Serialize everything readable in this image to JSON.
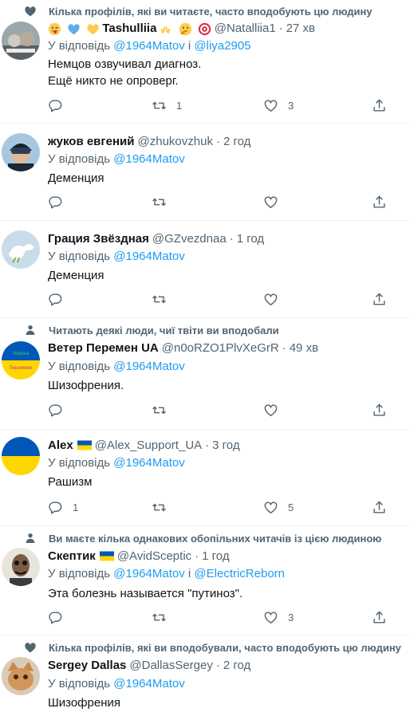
{
  "tweets": [
    {
      "social": "Кілька профілів, які ви читаєте, часто вподобують цю людину",
      "social_icon": "heart-icon",
      "name": "Tashulliia",
      "handle": "@Natalliia1",
      "time": "27 хв",
      "reply_prefix": "У відповідь",
      "reply_to": [
        "@1964Matov",
        "@liya2905"
      ],
      "reply_joiner": "і",
      "text": "Немцов озвучивал диагноз.\nЕщё никто не опроверг.",
      "replies": "",
      "retweets": "1",
      "likes": "3"
    },
    {
      "social": "",
      "name": "жуков евгений",
      "handle": "@zhukovzhuk",
      "time": "2 год",
      "reply_prefix": "У відповідь",
      "reply_to": [
        "@1964Matov"
      ],
      "text": "Деменция",
      "replies": "",
      "retweets": "",
      "likes": ""
    },
    {
      "social": "",
      "name": "Грация Звёздная",
      "handle": "@GZvezdnaa",
      "time": "1 год",
      "reply_prefix": "У відповідь",
      "reply_to": [
        "@1964Matov"
      ],
      "text": "Деменция",
      "replies": "",
      "retweets": "",
      "likes": ""
    },
    {
      "social": "Читають деякі люди, чиї твіти ви вподобали",
      "social_icon": "person-icon",
      "name": "Ветер Перемен UA",
      "handle": "@n0oRZO1PlvXeGrR",
      "time": "49 хв",
      "reply_prefix": "У відповідь",
      "reply_to": [
        "@1964Matov"
      ],
      "text": "Шизофрения.",
      "replies": "",
      "retweets": "",
      "likes": "",
      "avatar_text_top": "Україна",
      "avatar_text_bottom": "Переможе"
    },
    {
      "social": "",
      "name": "Alex",
      "handle": "@Alex_Support_UA",
      "time": "3 год",
      "reply_prefix": "У відповідь",
      "reply_to": [
        "@1964Matov"
      ],
      "text": "Рашизм",
      "replies": "1",
      "retweets": "",
      "likes": "5"
    },
    {
      "social": "Ви маєте кілька однакових обопільних читачів із цією людиною",
      "social_icon": "person-icon",
      "name": "Скептик",
      "handle": "@AvidSceptic",
      "time": "1 год",
      "reply_prefix": "У відповідь",
      "reply_to": [
        "@1964Matov",
        "@ElectricReborn"
      ],
      "reply_joiner": "і",
      "text": "Эта болезнь называется \"путиноз\".",
      "replies": "",
      "retweets": "",
      "likes": "3"
    },
    {
      "social": "Кілька профілів, які ви вподобували, часто вподобують цю людину",
      "social_icon": "heart-icon",
      "name": "Sergey Dallas",
      "handle": "@DallasSergey",
      "time": "2 год",
      "reply_prefix": "У відповідь",
      "reply_to": [
        "@1964Matov"
      ],
      "text": "Шизофрения",
      "replies": "",
      "retweets": "",
      "likes": ""
    }
  ],
  "colors": {
    "link": "#1d9bf0",
    "secondary": "#536471",
    "divider": "#eff3f4",
    "ua_blue": "#0057b7",
    "ua_yellow": "#ffd700"
  }
}
